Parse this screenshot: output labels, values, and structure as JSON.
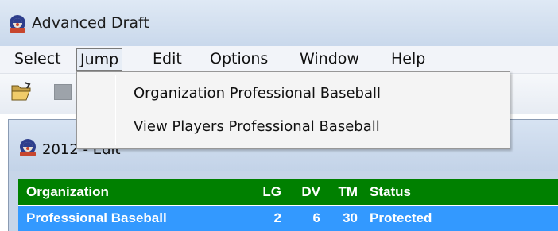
{
  "window": {
    "title": "Advanced Draft",
    "icon": "baseball-app-icon"
  },
  "menubar": {
    "items": [
      {
        "label": "Select",
        "active": false
      },
      {
        "label": "Jump",
        "active": true
      },
      {
        "label": "Edit",
        "active": false
      },
      {
        "label": "Options",
        "active": false
      },
      {
        "label": "Window",
        "active": false
      },
      {
        "label": "Help",
        "active": false
      }
    ]
  },
  "toolbar": {
    "buttons": [
      {
        "icon": "open-folder-icon"
      },
      {
        "icon": "disabled-button-icon"
      }
    ]
  },
  "jump_menu": {
    "items": [
      {
        "label": "Organization  Professional Baseball"
      },
      {
        "label": "View Players  Professional Baseball"
      }
    ]
  },
  "child_window": {
    "title": "2012 - Edit",
    "icon": "baseball-app-icon"
  },
  "grid": {
    "columns": [
      "Organization",
      "LG",
      "DV",
      "TM",
      "Status"
    ],
    "rows": [
      {
        "organization": "Professional Baseball",
        "lg": "2",
        "dv": "6",
        "tm": "30",
        "status": "Protected",
        "selected": true
      }
    ]
  },
  "colors": {
    "grid_header_bg": "#008000",
    "selected_row_bg": "#3399ff"
  }
}
